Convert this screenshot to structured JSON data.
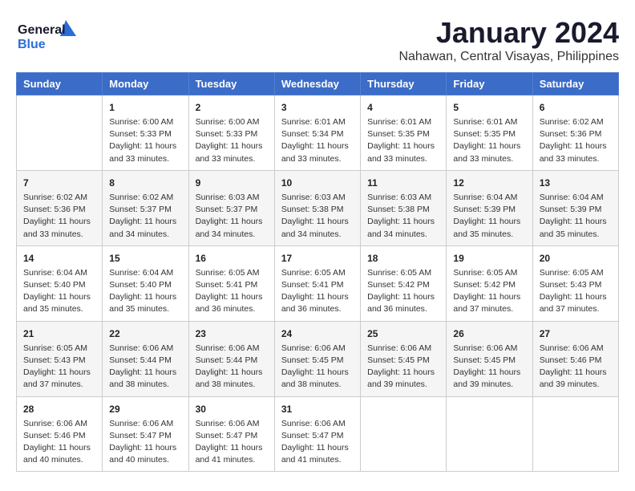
{
  "header": {
    "logo_line1": "General",
    "logo_line2": "Blue",
    "main_title": "January 2024",
    "subtitle": "Nahawan, Central Visayas, Philippines"
  },
  "days_of_week": [
    "Sunday",
    "Monday",
    "Tuesday",
    "Wednesday",
    "Thursday",
    "Friday",
    "Saturday"
  ],
  "weeks": [
    [
      {
        "day": "",
        "sunrise": "",
        "sunset": "",
        "daylight": ""
      },
      {
        "day": "1",
        "sunrise": "Sunrise: 6:00 AM",
        "sunset": "Sunset: 5:33 PM",
        "daylight": "Daylight: 11 hours and 33 minutes."
      },
      {
        "day": "2",
        "sunrise": "Sunrise: 6:00 AM",
        "sunset": "Sunset: 5:33 PM",
        "daylight": "Daylight: 11 hours and 33 minutes."
      },
      {
        "day": "3",
        "sunrise": "Sunrise: 6:01 AM",
        "sunset": "Sunset: 5:34 PM",
        "daylight": "Daylight: 11 hours and 33 minutes."
      },
      {
        "day": "4",
        "sunrise": "Sunrise: 6:01 AM",
        "sunset": "Sunset: 5:35 PM",
        "daylight": "Daylight: 11 hours and 33 minutes."
      },
      {
        "day": "5",
        "sunrise": "Sunrise: 6:01 AM",
        "sunset": "Sunset: 5:35 PM",
        "daylight": "Daylight: 11 hours and 33 minutes."
      },
      {
        "day": "6",
        "sunrise": "Sunrise: 6:02 AM",
        "sunset": "Sunset: 5:36 PM",
        "daylight": "Daylight: 11 hours and 33 minutes."
      }
    ],
    [
      {
        "day": "7",
        "sunrise": "Sunrise: 6:02 AM",
        "sunset": "Sunset: 5:36 PM",
        "daylight": "Daylight: 11 hours and 33 minutes."
      },
      {
        "day": "8",
        "sunrise": "Sunrise: 6:02 AM",
        "sunset": "Sunset: 5:37 PM",
        "daylight": "Daylight: 11 hours and 34 minutes."
      },
      {
        "day": "9",
        "sunrise": "Sunrise: 6:03 AM",
        "sunset": "Sunset: 5:37 PM",
        "daylight": "Daylight: 11 hours and 34 minutes."
      },
      {
        "day": "10",
        "sunrise": "Sunrise: 6:03 AM",
        "sunset": "Sunset: 5:38 PM",
        "daylight": "Daylight: 11 hours and 34 minutes."
      },
      {
        "day": "11",
        "sunrise": "Sunrise: 6:03 AM",
        "sunset": "Sunset: 5:38 PM",
        "daylight": "Daylight: 11 hours and 34 minutes."
      },
      {
        "day": "12",
        "sunrise": "Sunrise: 6:04 AM",
        "sunset": "Sunset: 5:39 PM",
        "daylight": "Daylight: 11 hours and 35 minutes."
      },
      {
        "day": "13",
        "sunrise": "Sunrise: 6:04 AM",
        "sunset": "Sunset: 5:39 PM",
        "daylight": "Daylight: 11 hours and 35 minutes."
      }
    ],
    [
      {
        "day": "14",
        "sunrise": "Sunrise: 6:04 AM",
        "sunset": "Sunset: 5:40 PM",
        "daylight": "Daylight: 11 hours and 35 minutes."
      },
      {
        "day": "15",
        "sunrise": "Sunrise: 6:04 AM",
        "sunset": "Sunset: 5:40 PM",
        "daylight": "Daylight: 11 hours and 35 minutes."
      },
      {
        "day": "16",
        "sunrise": "Sunrise: 6:05 AM",
        "sunset": "Sunset: 5:41 PM",
        "daylight": "Daylight: 11 hours and 36 minutes."
      },
      {
        "day": "17",
        "sunrise": "Sunrise: 6:05 AM",
        "sunset": "Sunset: 5:41 PM",
        "daylight": "Daylight: 11 hours and 36 minutes."
      },
      {
        "day": "18",
        "sunrise": "Sunrise: 6:05 AM",
        "sunset": "Sunset: 5:42 PM",
        "daylight": "Daylight: 11 hours and 36 minutes."
      },
      {
        "day": "19",
        "sunrise": "Sunrise: 6:05 AM",
        "sunset": "Sunset: 5:42 PM",
        "daylight": "Daylight: 11 hours and 37 minutes."
      },
      {
        "day": "20",
        "sunrise": "Sunrise: 6:05 AM",
        "sunset": "Sunset: 5:43 PM",
        "daylight": "Daylight: 11 hours and 37 minutes."
      }
    ],
    [
      {
        "day": "21",
        "sunrise": "Sunrise: 6:05 AM",
        "sunset": "Sunset: 5:43 PM",
        "daylight": "Daylight: 11 hours and 37 minutes."
      },
      {
        "day": "22",
        "sunrise": "Sunrise: 6:06 AM",
        "sunset": "Sunset: 5:44 PM",
        "daylight": "Daylight: 11 hours and 38 minutes."
      },
      {
        "day": "23",
        "sunrise": "Sunrise: 6:06 AM",
        "sunset": "Sunset: 5:44 PM",
        "daylight": "Daylight: 11 hours and 38 minutes."
      },
      {
        "day": "24",
        "sunrise": "Sunrise: 6:06 AM",
        "sunset": "Sunset: 5:45 PM",
        "daylight": "Daylight: 11 hours and 38 minutes."
      },
      {
        "day": "25",
        "sunrise": "Sunrise: 6:06 AM",
        "sunset": "Sunset: 5:45 PM",
        "daylight": "Daylight: 11 hours and 39 minutes."
      },
      {
        "day": "26",
        "sunrise": "Sunrise: 6:06 AM",
        "sunset": "Sunset: 5:45 PM",
        "daylight": "Daylight: 11 hours and 39 minutes."
      },
      {
        "day": "27",
        "sunrise": "Sunrise: 6:06 AM",
        "sunset": "Sunset: 5:46 PM",
        "daylight": "Daylight: 11 hours and 39 minutes."
      }
    ],
    [
      {
        "day": "28",
        "sunrise": "Sunrise: 6:06 AM",
        "sunset": "Sunset: 5:46 PM",
        "daylight": "Daylight: 11 hours and 40 minutes."
      },
      {
        "day": "29",
        "sunrise": "Sunrise: 6:06 AM",
        "sunset": "Sunset: 5:47 PM",
        "daylight": "Daylight: 11 hours and 40 minutes."
      },
      {
        "day": "30",
        "sunrise": "Sunrise: 6:06 AM",
        "sunset": "Sunset: 5:47 PM",
        "daylight": "Daylight: 11 hours and 41 minutes."
      },
      {
        "day": "31",
        "sunrise": "Sunrise: 6:06 AM",
        "sunset": "Sunset: 5:47 PM",
        "daylight": "Daylight: 11 hours and 41 minutes."
      },
      {
        "day": "",
        "sunrise": "",
        "sunset": "",
        "daylight": ""
      },
      {
        "day": "",
        "sunrise": "",
        "sunset": "",
        "daylight": ""
      },
      {
        "day": "",
        "sunrise": "",
        "sunset": "",
        "daylight": ""
      }
    ]
  ]
}
